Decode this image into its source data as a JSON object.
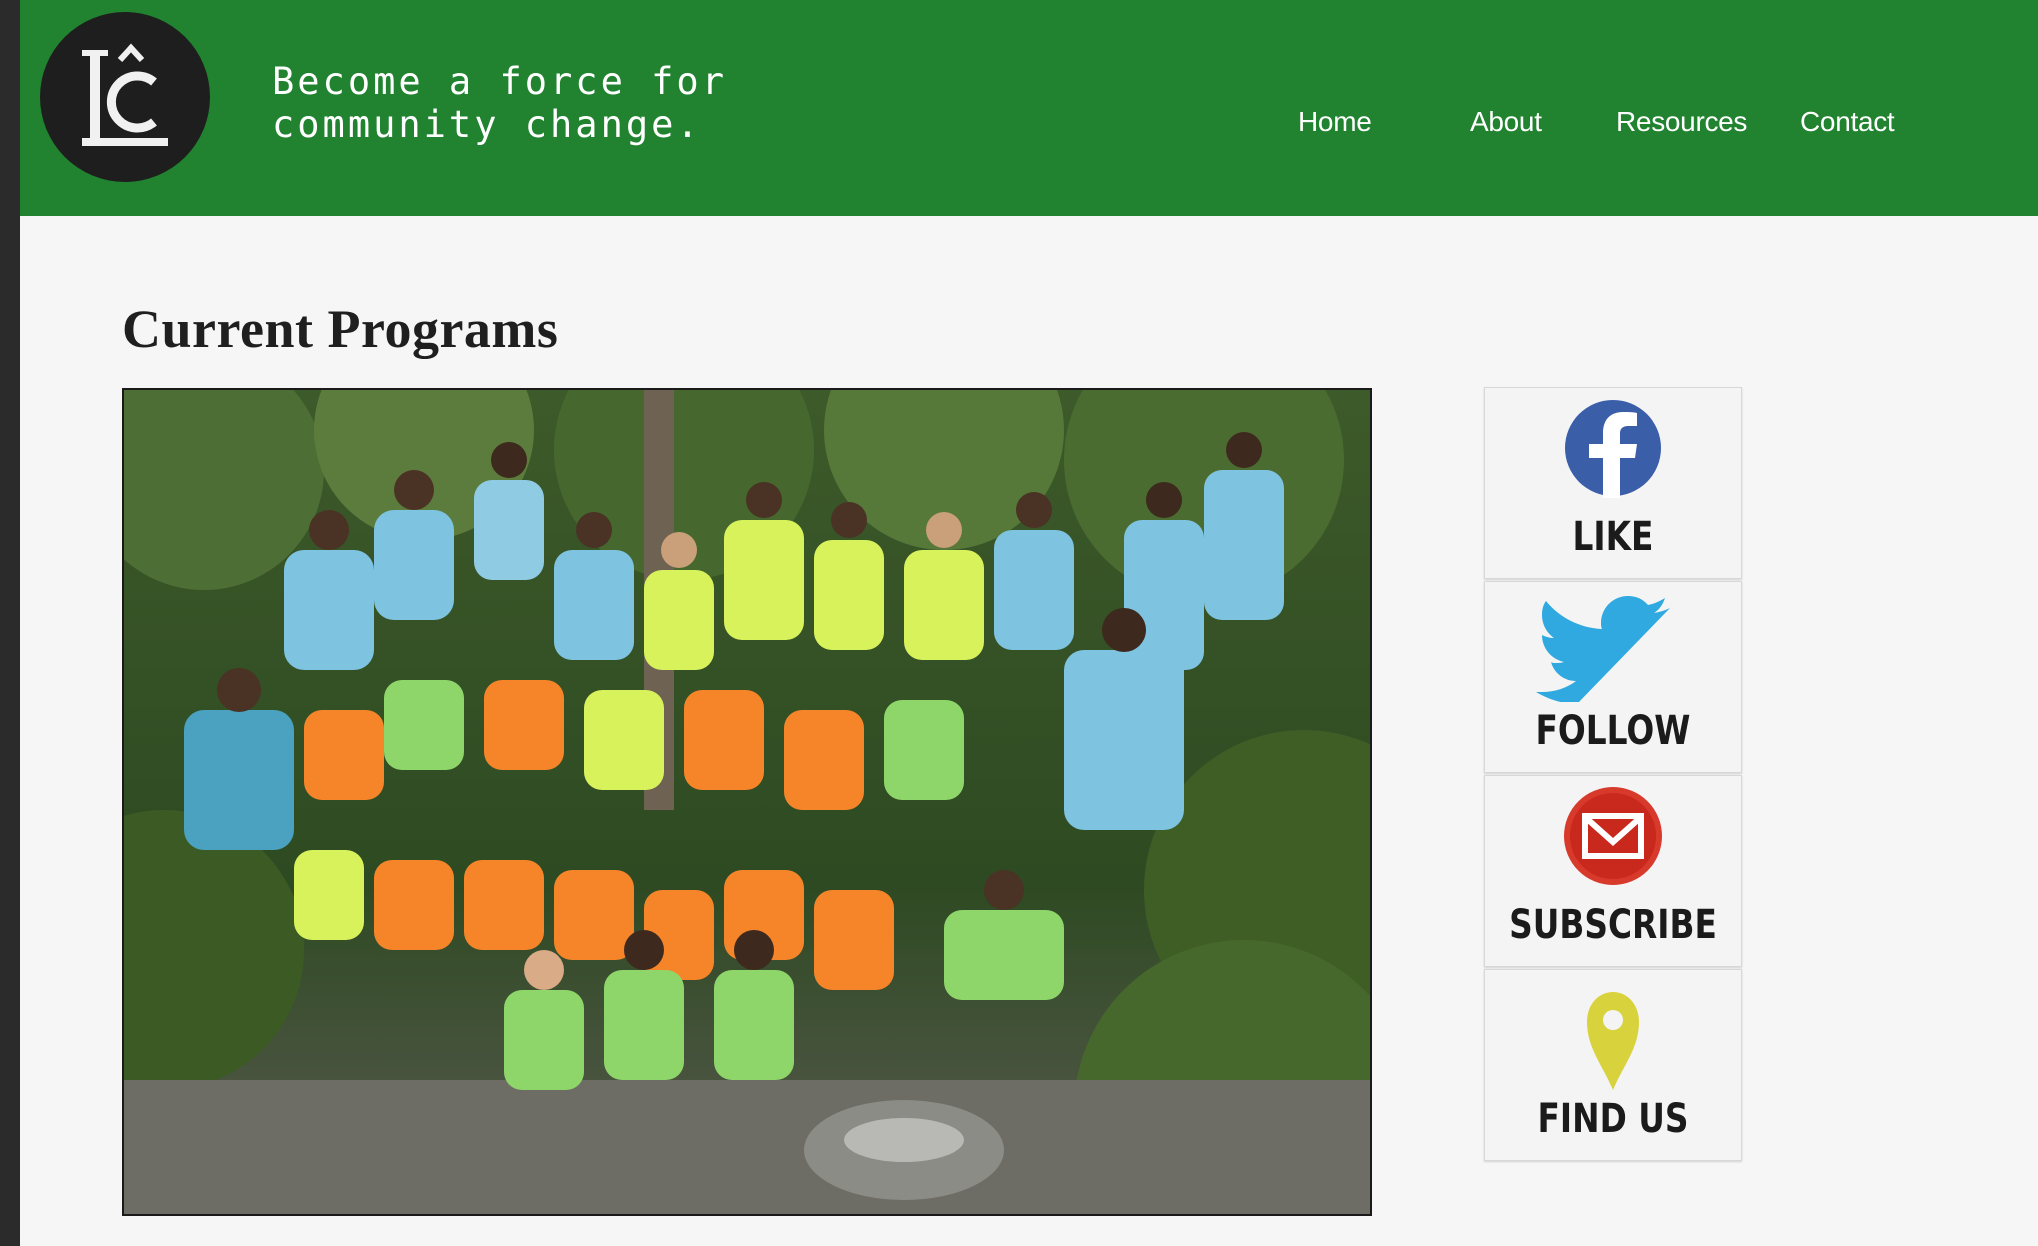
{
  "header": {
    "tagline_line1": "Become a force for",
    "tagline_line2": "community change.",
    "logo_icon": "lc-monogram-logo",
    "nav": [
      {
        "label": "Home"
      },
      {
        "label": "About"
      },
      {
        "label": "Resources"
      },
      {
        "label": "Contact"
      }
    ]
  },
  "main": {
    "title": "Current Programs",
    "photo_subject": "group-photo"
  },
  "social": [
    {
      "label": "LIKE",
      "icon": "facebook-icon"
    },
    {
      "label": "FOLLOW",
      "icon": "twitter-icon"
    },
    {
      "label": "SUBSCRIBE",
      "icon": "email-icon"
    },
    {
      "label": "FIND US",
      "icon": "map-pin-icon"
    }
  ],
  "colors": {
    "header_green": "#218330",
    "facebook_blue": "#3b5ea8",
    "twitter_blue": "#2fa9e0",
    "email_red": "#d7392b",
    "pin_yellow": "#d8d23c"
  }
}
